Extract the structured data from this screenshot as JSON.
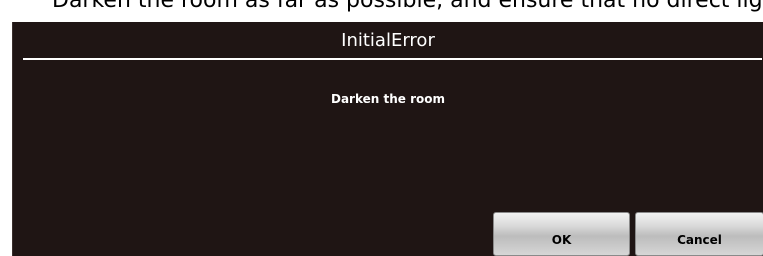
{
  "background_text": "Darken the room as far as possible, and ensure that no direct light is shining on the images that appear",
  "dialog": {
    "title": "InitialError",
    "message": "Darken the room",
    "buttons": {
      "ok_label": "OK",
      "cancel_label": "Cancel"
    }
  },
  "colors": {
    "dialog_background": "#1f1514",
    "text": "#ffffff",
    "button_face": "#d6d6d6"
  }
}
